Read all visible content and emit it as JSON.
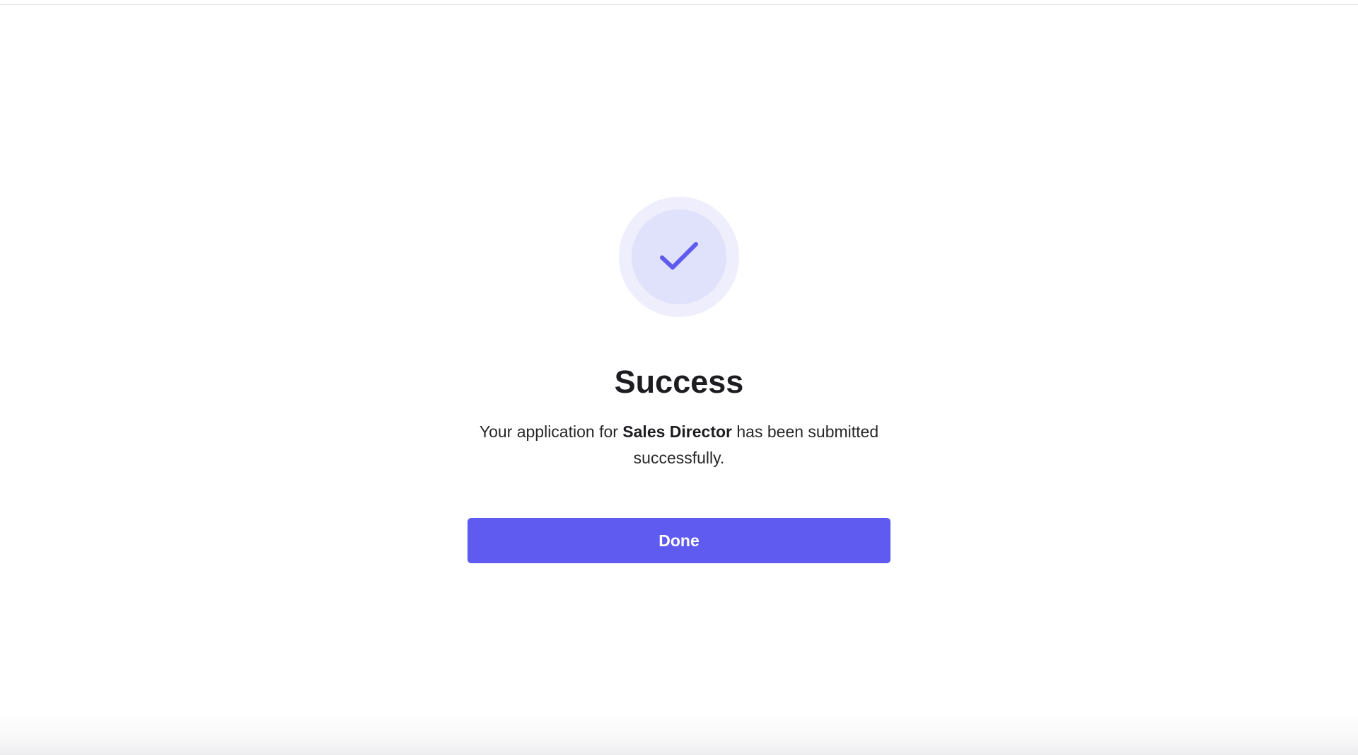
{
  "success": {
    "icon": "checkmark-icon",
    "title": "Success",
    "message": {
      "before": "Your application for ",
      "position": "Sales Director",
      "after": " has been submitted successfully."
    },
    "done_label": "Done"
  },
  "colors": {
    "accent": "#5f5bf0",
    "badge_outer": "#eeeefc",
    "badge_inner": "#e0e1fb",
    "heading": "#1d1d21"
  }
}
